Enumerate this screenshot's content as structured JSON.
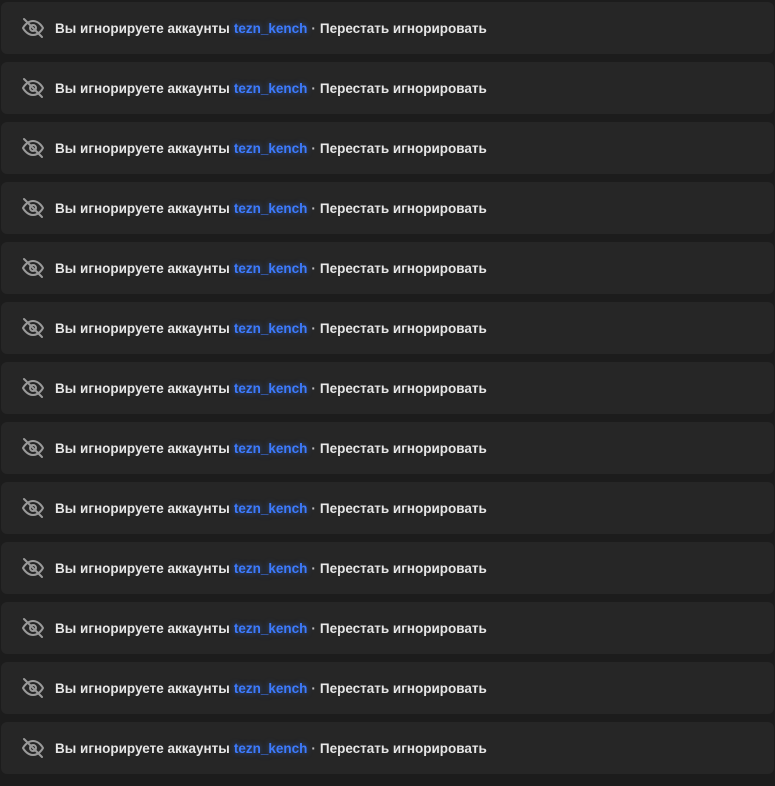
{
  "colors": {
    "background": "#1c1c1c",
    "row_background": "#262626",
    "text": "#e6e6e6",
    "username": "#3d7bff",
    "icon": "#9a9a9a"
  },
  "ignored_notices": [
    {
      "icon": "eye-off-icon",
      "prefix": "Вы игнорируете аккаунты",
      "username": "tezn_kench",
      "separator": "·",
      "action": "Перестать игнорировать"
    },
    {
      "icon": "eye-off-icon",
      "prefix": "Вы игнорируете аккаунты",
      "username": "tezn_kench",
      "separator": "·",
      "action": "Перестать игнорировать"
    },
    {
      "icon": "eye-off-icon",
      "prefix": "Вы игнорируете аккаунты",
      "username": "tezn_kench",
      "separator": "·",
      "action": "Перестать игнорировать"
    },
    {
      "icon": "eye-off-icon",
      "prefix": "Вы игнорируете аккаунты",
      "username": "tezn_kench",
      "separator": "·",
      "action": "Перестать игнорировать"
    },
    {
      "icon": "eye-off-icon",
      "prefix": "Вы игнорируете аккаунты",
      "username": "tezn_kench",
      "separator": "·",
      "action": "Перестать игнорировать"
    },
    {
      "icon": "eye-off-icon",
      "prefix": "Вы игнорируете аккаунты",
      "username": "tezn_kench",
      "separator": "·",
      "action": "Перестать игнорировать"
    },
    {
      "icon": "eye-off-icon",
      "prefix": "Вы игнорируете аккаунты",
      "username": "tezn_kench",
      "separator": "·",
      "action": "Перестать игнорировать"
    },
    {
      "icon": "eye-off-icon",
      "prefix": "Вы игнорируете аккаунты",
      "username": "tezn_kench",
      "separator": "·",
      "action": "Перестать игнорировать"
    },
    {
      "icon": "eye-off-icon",
      "prefix": "Вы игнорируете аккаунты",
      "username": "tezn_kench",
      "separator": "·",
      "action": "Перестать игнорировать"
    },
    {
      "icon": "eye-off-icon",
      "prefix": "Вы игнорируете аккаунты",
      "username": "tezn_kench",
      "separator": "·",
      "action": "Перестать игнорировать"
    },
    {
      "icon": "eye-off-icon",
      "prefix": "Вы игнорируете аккаунты",
      "username": "tezn_kench",
      "separator": "·",
      "action": "Перестать игнорировать"
    },
    {
      "icon": "eye-off-icon",
      "prefix": "Вы игнорируете аккаунты",
      "username": "tezn_kench",
      "separator": "·",
      "action": "Перестать игнорировать"
    },
    {
      "icon": "eye-off-icon",
      "prefix": "Вы игнорируете аккаунты",
      "username": "tezn_kench",
      "separator": "·",
      "action": "Перестать игнорировать"
    }
  ]
}
